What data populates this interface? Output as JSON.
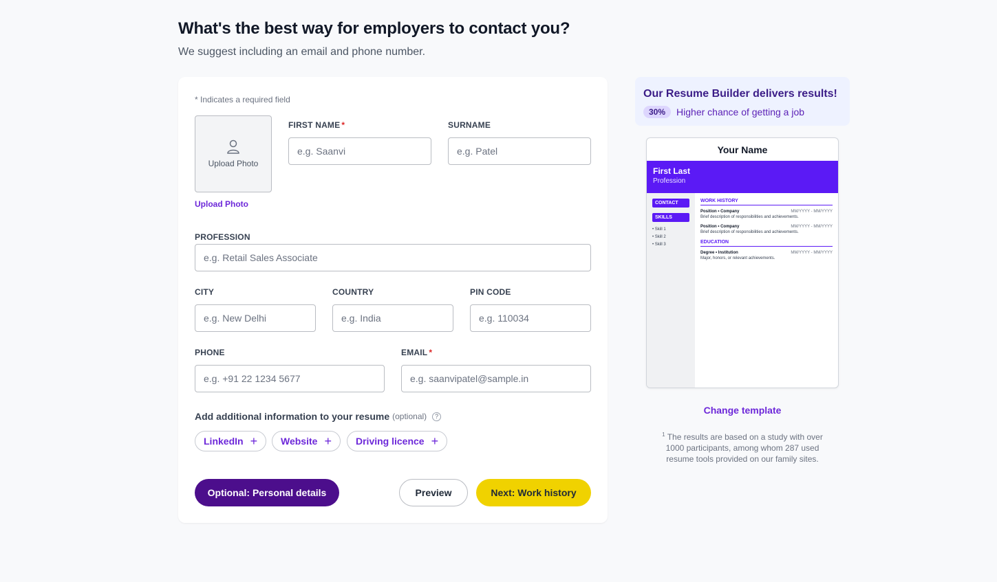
{
  "page": {
    "title": "What's the best way for employers to contact you?",
    "subtitle": "We suggest including an email and phone number."
  },
  "form": {
    "required_note": "* Indicates a required field",
    "photo_box_label": "Upload Photo",
    "photo_link": "Upload Photo",
    "first_name": {
      "label": "FIRST NAME",
      "required": "*",
      "placeholder": "e.g. Saanvi"
    },
    "surname": {
      "label": "SURNAME",
      "placeholder": "e.g. Patel"
    },
    "profession": {
      "label": "PROFESSION",
      "placeholder": "e.g. Retail Sales Associate"
    },
    "city": {
      "label": "CITY",
      "placeholder": "e.g. New Delhi"
    },
    "country": {
      "label": "COUNTRY",
      "placeholder": "e.g. India"
    },
    "pin_code": {
      "label": "PIN CODE",
      "placeholder": "e.g. 110034"
    },
    "phone": {
      "label": "PHONE",
      "placeholder": "e.g. +91 22 1234 5677"
    },
    "email": {
      "label": "EMAIL",
      "required": "*",
      "placeholder": "e.g. saanvipatel@sample.in"
    },
    "additional": {
      "label": "Add additional information to your resume",
      "optional": "(optional)",
      "help_icon": "?"
    },
    "chips": [
      "LinkedIn",
      "Website",
      "Driving licence"
    ],
    "chip_plus": "+",
    "buttons": {
      "personal": "Optional: Personal details",
      "preview": "Preview",
      "next": "Next: Work history"
    }
  },
  "sidebar": {
    "promo_title": "Our Resume Builder delivers results!",
    "promo_badge": "30%",
    "promo_text": "Higher chance of getting a job",
    "template": {
      "name": "Your Name",
      "first_last": "First Last",
      "profession": "Profession",
      "contact": "CONTACT",
      "skills": "SKILLS",
      "skill_items": [
        "• Skill 1",
        "• Skill 2",
        "• Skill 3"
      ],
      "work_history": "WORK HISTORY",
      "job_title": "Position • Company",
      "job_dates": "MM/YYYY - MM/YYYY",
      "job_desc": "Brief description of responsibilities and achievements.",
      "education": "EDUCATION",
      "edu_title": "Degree • Institution",
      "edu_dates": "MM/YYYY - MM/YYYY",
      "edu_desc": "Major, honors, or relevant achievements."
    },
    "change_template": "Change template",
    "footnote_mark": "1",
    "footnote": " The results are based on a study with over 1000 participants, among whom 287 used resume tools provided on our family sites."
  },
  "colors": {
    "accent": "#6d28d9",
    "primary_button": "#4c0e8c",
    "next_button": "#f0d200",
    "template_header": "#5b1af5",
    "required_star": "#dc2626"
  }
}
